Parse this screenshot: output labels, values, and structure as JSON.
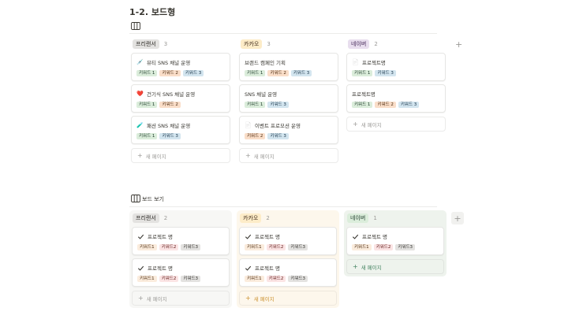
{
  "page": {
    "title": "1-2. 보드형",
    "add_symbol": "+",
    "new_page": "새 페이지"
  },
  "board1": {
    "columns": [
      {
        "name": "프리랜서",
        "count": "3",
        "pill_bg": "#e3e2e0",
        "pill_fg": "#32302c",
        "cards": [
          {
            "icon": "💉",
            "title": "뷰티 SNS 채널 운영",
            "tags": [
              "키워드 1",
              "키워드 2",
              "키워드 3"
            ]
          },
          {
            "icon": "❤️",
            "title": "건기식 SNS 채널 운영",
            "tags": [
              "키워드 1",
              "키워드 2"
            ]
          },
          {
            "icon": "🧪",
            "title": "패션 SNS 채널 운영",
            "tags": [
              "키워드 1",
              "키워드 3"
            ]
          }
        ]
      },
      {
        "name": "카카오",
        "count": "3",
        "pill_bg": "#fdecc8",
        "pill_fg": "#402c1b",
        "cards": [
          {
            "icon": "",
            "title": "브랜드 캠페인 기획",
            "tags": [
              "키워드 1",
              "키워드 2",
              "키워드 3"
            ]
          },
          {
            "icon": "",
            "title": "SNS 채널 운영",
            "tags": [
              "키워드 1",
              "키워드 3"
            ]
          },
          {
            "icon": "📄",
            "title": "이벤트 프로모션 운영",
            "tags": [
              "키워드 2",
              "키워드 3"
            ]
          }
        ]
      },
      {
        "name": "네이버",
        "count": "2",
        "pill_bg": "#e8deee",
        "pill_fg": "#412454",
        "cards": [
          {
            "icon": "📄",
            "title": "프로젝트명",
            "tags": [
              "키워드 1",
              "키워드 3"
            ]
          },
          {
            "icon": "",
            "title": "프로젝트명",
            "tags": [
              "키워드 1",
              "키워드 2",
              "키워드 3"
            ]
          }
        ]
      }
    ]
  },
  "board2": {
    "view_label": "보드 보기",
    "columns": [
      {
        "name": "프리랜서",
        "count": "2",
        "pill_bg": "#e3e2e0",
        "pill_fg": "#32302c",
        "col_bg": "#f7f7f5",
        "new_color": "#9b9a97",
        "cards": [
          {
            "title": "프로젝트 명",
            "tags": [
              "키워드1",
              "키워드2",
              "키워드3"
            ]
          },
          {
            "title": "프로젝트 명",
            "tags": [
              "키워드1",
              "키워드2",
              "키워드3"
            ]
          }
        ]
      },
      {
        "name": "카카오",
        "count": "2",
        "pill_bg": "#fdecc8",
        "pill_fg": "#402c1b",
        "col_bg": "#fdf7ec",
        "new_color": "#cb912f",
        "cards": [
          {
            "title": "프로젝트 명",
            "tags": [
              "키워드1",
              "키워드2",
              "키워드3"
            ]
          },
          {
            "title": "프로젝트 명",
            "tags": [
              "키워드1",
              "키워드2",
              "키워드3"
            ]
          }
        ]
      },
      {
        "name": "네이버",
        "count": "1",
        "pill_bg": "#dbeddb",
        "pill_fg": "#1c3829",
        "col_bg": "#eef3ed",
        "new_color": "#448361",
        "cards": [
          {
            "title": "프로젝트 명",
            "tags": [
              "키워드1",
              "키워드2",
              "키워드3"
            ]
          }
        ]
      }
    ]
  }
}
